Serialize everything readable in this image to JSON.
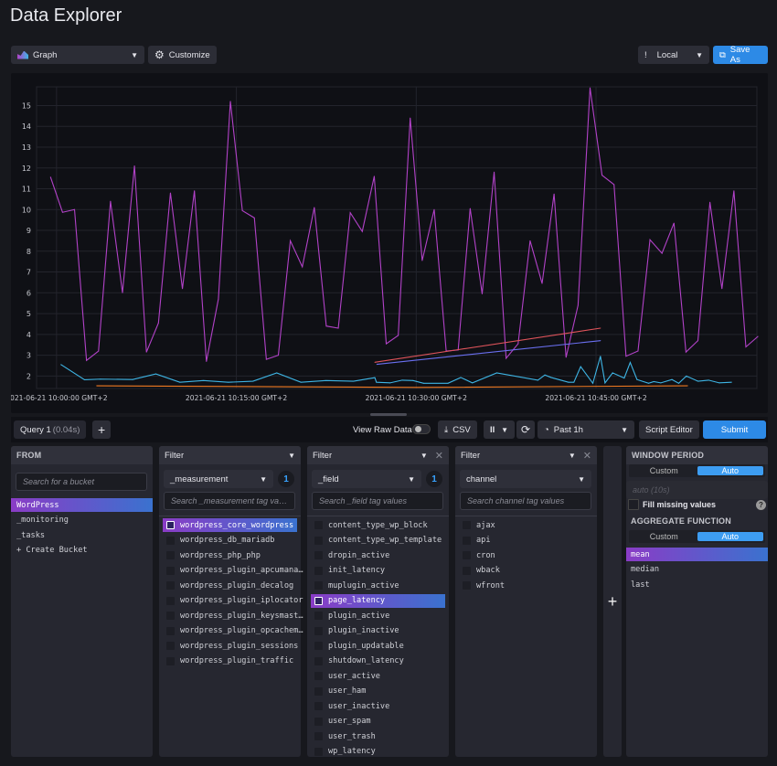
{
  "title": "Data Explorer",
  "toolbar": {
    "graph_label": "Graph",
    "customize_label": "Customize",
    "timezone": "Local",
    "save_as": "Save As"
  },
  "query_bar": {
    "query_tab": "Query 1",
    "query_time": "(0.04s)",
    "add_query": "+",
    "view_raw": "View Raw Data",
    "view_raw_on": false,
    "csv": "CSV",
    "pause": "II",
    "time_range": "Past 1h",
    "script_editor": "Script Editor",
    "submit": "Submit"
  },
  "from": {
    "header": "FROM",
    "placeholder": "Search for a bucket",
    "buckets": [
      "WordPress",
      "_monitoring",
      "_tasks",
      "+ Create Bucket"
    ],
    "selected": "WordPress"
  },
  "filters": [
    {
      "header": "Filter",
      "key": "_measurement",
      "count": "1",
      "placeholder": "Search _measurement tag va…",
      "values": [
        "wordpress_core_wordpress",
        "wordpress_db_mariadb",
        "wordpress_php_php",
        "wordpress_plugin_apcumana…",
        "wordpress_plugin_decalog",
        "wordpress_plugin_iplocator",
        "wordpress_plugin_keysmast…",
        "wordpress_plugin_opcachem…",
        "wordpress_plugin_sessions",
        "wordpress_plugin_traffic"
      ],
      "selected": [
        0
      ]
    },
    {
      "header": "Filter",
      "key": "_field",
      "count": "1",
      "placeholder": "Search _field tag values",
      "values": [
        "content_type_wp_block",
        "content_type_wp_template",
        "dropin_active",
        "init_latency",
        "muplugin_active",
        "page_latency",
        "plugin_active",
        "plugin_inactive",
        "plugin_updatable",
        "shutdown_latency",
        "user_active",
        "user_ham",
        "user_inactive",
        "user_spam",
        "user_trash",
        "wp_latency"
      ],
      "selected": [
        5
      ]
    },
    {
      "header": "Filter",
      "key": "channel",
      "count": "",
      "placeholder": "Search channel tag values",
      "values": [
        "ajax",
        "api",
        "cron",
        "wback",
        "wfront"
      ],
      "selected": []
    }
  ],
  "add_filter": "+",
  "window": {
    "header": "WINDOW PERIOD",
    "custom": "Custom",
    "auto": "Auto",
    "auto_placeholder": "auto (10s)",
    "fill_missing": "Fill missing values",
    "help": "?",
    "agg_header": "AGGREGATE FUNCTION",
    "agg_custom": "Custom",
    "agg_auto": "Auto",
    "functions": [
      "mean",
      "median",
      "last"
    ],
    "selected_function": "mean"
  },
  "chart_data": {
    "type": "line",
    "x_axis": "time",
    "xlim": [
      "09:58:20",
      "10:58:25"
    ],
    "ylim": [
      1.4,
      15.9
    ],
    "x_ticks": [
      "10:00:00",
      "10:15:00",
      "10:30:00",
      "10:45:00"
    ],
    "x_tick_labels": [
      "2021-06-21 10:00:00 GMT+2",
      "2021-06-21 10:15:00 GMT+2",
      "2021-06-21 10:30:00 GMT+2",
      "2021-06-21 10:45:00 GMT+2"
    ],
    "y_ticks": [
      2,
      3,
      4,
      5,
      6,
      7,
      8,
      9,
      10,
      11,
      12,
      13,
      14,
      15
    ],
    "grid": true,
    "series": [
      {
        "color": "#b242c8",
        "start": "09:59:30",
        "step_seconds": 60,
        "values": [
          11.56,
          9.87,
          10.0,
          2.75,
          3.2,
          10.4,
          6.0,
          12.1,
          3.15,
          4.55,
          10.8,
          6.2,
          10.9,
          2.7,
          5.7,
          15.2,
          9.95,
          9.6,
          2.8,
          3.0,
          8.5,
          7.25,
          10.1,
          4.4,
          4.3,
          9.85,
          8.95,
          11.6,
          3.55,
          3.95,
          14.4,
          7.55,
          10.0,
          3.2,
          3.25,
          10.05,
          5.95,
          11.8,
          2.85,
          3.55,
          8.5,
          6.45,
          10.75,
          2.9,
          5.4,
          15.85,
          11.65,
          11.2,
          2.95,
          3.2,
          8.55,
          7.9,
          9.35,
          3.15,
          3.7,
          10.35,
          6.2,
          10.9,
          3.4,
          3.9
        ]
      },
      {
        "color": "#3eb5e5",
        "points": [
          [
            "10:00:22",
            2.55
          ],
          [
            "10:02:20",
            1.82
          ],
          [
            "10:03:40",
            1.85
          ],
          [
            "10:06:21",
            1.83
          ],
          [
            "10:08:17",
            2.1
          ],
          [
            "10:10:17",
            1.7
          ],
          [
            "10:12:15",
            1.78
          ],
          [
            "10:14:20",
            1.7
          ],
          [
            "10:16:23",
            1.75
          ],
          [
            "10:18:22",
            2.15
          ],
          [
            "10:20:23",
            1.7
          ],
          [
            "10:22:29",
            1.78
          ],
          [
            "10:24:46",
            1.75
          ],
          [
            "10:26:33",
            1.92
          ],
          [
            "10:26:41",
            1.7
          ],
          [
            "10:27:49",
            1.67
          ],
          [
            "10:28:50",
            1.8
          ],
          [
            "10:29:44",
            1.78
          ],
          [
            "10:30:37",
            1.65
          ],
          [
            "10:32:39",
            1.65
          ],
          [
            "10:33:43",
            1.93
          ],
          [
            "10:34:41",
            1.67
          ],
          [
            "10:36:43",
            2.15
          ],
          [
            "10:40:09",
            1.8
          ],
          [
            "10:40:44",
            2.05
          ],
          [
            "10:41:15",
            1.93
          ],
          [
            "10:42:42",
            1.7
          ],
          [
            "10:43:09",
            1.7
          ],
          [
            "10:43:43",
            2.45
          ],
          [
            "10:44:44",
            1.65
          ],
          [
            "10:45:22",
            2.95
          ],
          [
            "10:45:45",
            1.67
          ],
          [
            "10:46:23",
            2.15
          ],
          [
            "10:47:21",
            1.9
          ],
          [
            "10:47:51",
            2.65
          ],
          [
            "10:48:25",
            1.83
          ],
          [
            "10:49:23",
            1.65
          ],
          [
            "10:49:49",
            1.73
          ],
          [
            "10:50:24",
            1.67
          ],
          [
            "10:51:20",
            1.83
          ],
          [
            "10:51:54",
            1.65
          ],
          [
            "10:52:32",
            2.0
          ],
          [
            "10:53:30",
            1.75
          ],
          [
            "10:54:23",
            1.8
          ],
          [
            "10:55:17",
            1.67
          ],
          [
            "10:56:18",
            1.7
          ]
        ]
      },
      {
        "color": "#f07a22",
        "points": [
          [
            "10:03:21",
            1.53
          ],
          [
            "10:30:00",
            1.45
          ],
          [
            "10:52:38",
            1.53
          ]
        ]
      },
      {
        "color": "#e0545b",
        "points": [
          [
            "10:26:33",
            2.66
          ],
          [
            "10:45:22",
            4.3
          ]
        ]
      },
      {
        "color": "#6a6ff0",
        "points": [
          [
            "10:26:43",
            2.56
          ],
          [
            "10:45:22",
            3.7
          ]
        ]
      }
    ]
  }
}
